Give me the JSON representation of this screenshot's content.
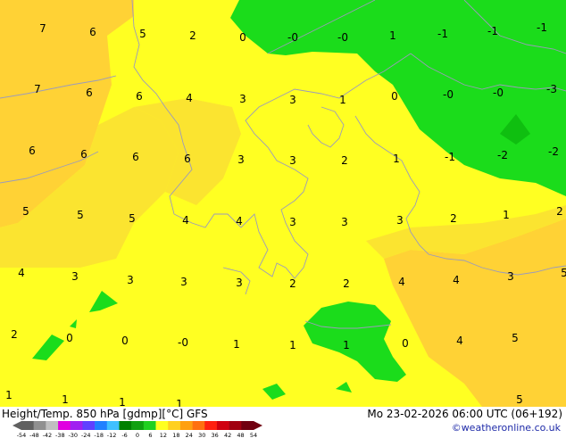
{
  "map": {
    "colors": {
      "yellow": "#ffff22",
      "orange": "#ffd235",
      "light_orange": "#fbe430",
      "green": "#1bdc1b",
      "dark_green": "#0fbf10",
      "coast": "#9b9bbb"
    },
    "labels": [
      {
        "t": "7"
      },
      {
        "t": "6"
      },
      {
        "t": "5"
      },
      {
        "t": "2"
      },
      {
        "t": "0"
      },
      {
        "t": "-0"
      },
      {
        "t": "-0"
      },
      {
        "t": "1"
      },
      {
        "t": "-1"
      },
      {
        "t": "-1"
      },
      {
        "t": "-1"
      },
      {
        "t": "7"
      },
      {
        "t": "6"
      },
      {
        "t": "6"
      },
      {
        "t": "4"
      },
      {
        "t": "3"
      },
      {
        "t": "3"
      },
      {
        "t": "1"
      },
      {
        "t": "0"
      },
      {
        "t": "-0"
      },
      {
        "t": "-0"
      },
      {
        "t": "-3"
      },
      {
        "t": "6"
      },
      {
        "t": "6"
      },
      {
        "t": "6"
      },
      {
        "t": "6"
      },
      {
        "t": "3"
      },
      {
        "t": "3"
      },
      {
        "t": "2"
      },
      {
        "t": "1"
      },
      {
        "t": "-1"
      },
      {
        "t": "-2"
      },
      {
        "t": "-2"
      },
      {
        "t": "5"
      },
      {
        "t": "5"
      },
      {
        "t": "5"
      },
      {
        "t": "4"
      },
      {
        "t": "4"
      },
      {
        "t": "3"
      },
      {
        "t": "3"
      },
      {
        "t": "3"
      },
      {
        "t": "2"
      },
      {
        "t": "1"
      },
      {
        "t": "2"
      },
      {
        "t": "4"
      },
      {
        "t": "3"
      },
      {
        "t": "3"
      },
      {
        "t": "3"
      },
      {
        "t": "3"
      },
      {
        "t": "2"
      },
      {
        "t": "2"
      },
      {
        "t": "4"
      },
      {
        "t": "4"
      },
      {
        "t": "3"
      },
      {
        "t": "5"
      },
      {
        "t": "2"
      },
      {
        "t": "0"
      },
      {
        "t": "0"
      },
      {
        "t": "-0"
      },
      {
        "t": "1"
      },
      {
        "t": "1"
      },
      {
        "t": "1"
      },
      {
        "t": "0"
      },
      {
        "t": "4"
      },
      {
        "t": "5"
      },
      {
        "t": "1"
      },
      {
        "t": "1"
      },
      {
        "t": "1"
      },
      {
        "t": "1"
      },
      {
        "t": "5"
      }
    ]
  },
  "footer": {
    "title_left": "Height/Temp. 850 hPa [gdmp][°C] GFS",
    "title_right": "Mo 23-02-2026 06:00 UTC (06+192)",
    "credit": "©weatheronline.co.uk",
    "colorbar": {
      "ticks": [
        "-54",
        "-48",
        "-42",
        "-38",
        "-30",
        "-24",
        "-18",
        "-12",
        "-6",
        "0",
        "6",
        "12",
        "18",
        "24",
        "30",
        "36",
        "42",
        "48",
        "54"
      ],
      "colors": [
        "#606060",
        "#909090",
        "#c0c0c0",
        "#e000e0",
        "#a020f0",
        "#6040ff",
        "#2080ff",
        "#40c0ff",
        "#008000",
        "#10a010",
        "#20d020",
        "#ffff20",
        "#ffd020",
        "#ffa010",
        "#ff7010",
        "#ff2010",
        "#d00010",
        "#a00010",
        "#700010"
      ]
    }
  }
}
